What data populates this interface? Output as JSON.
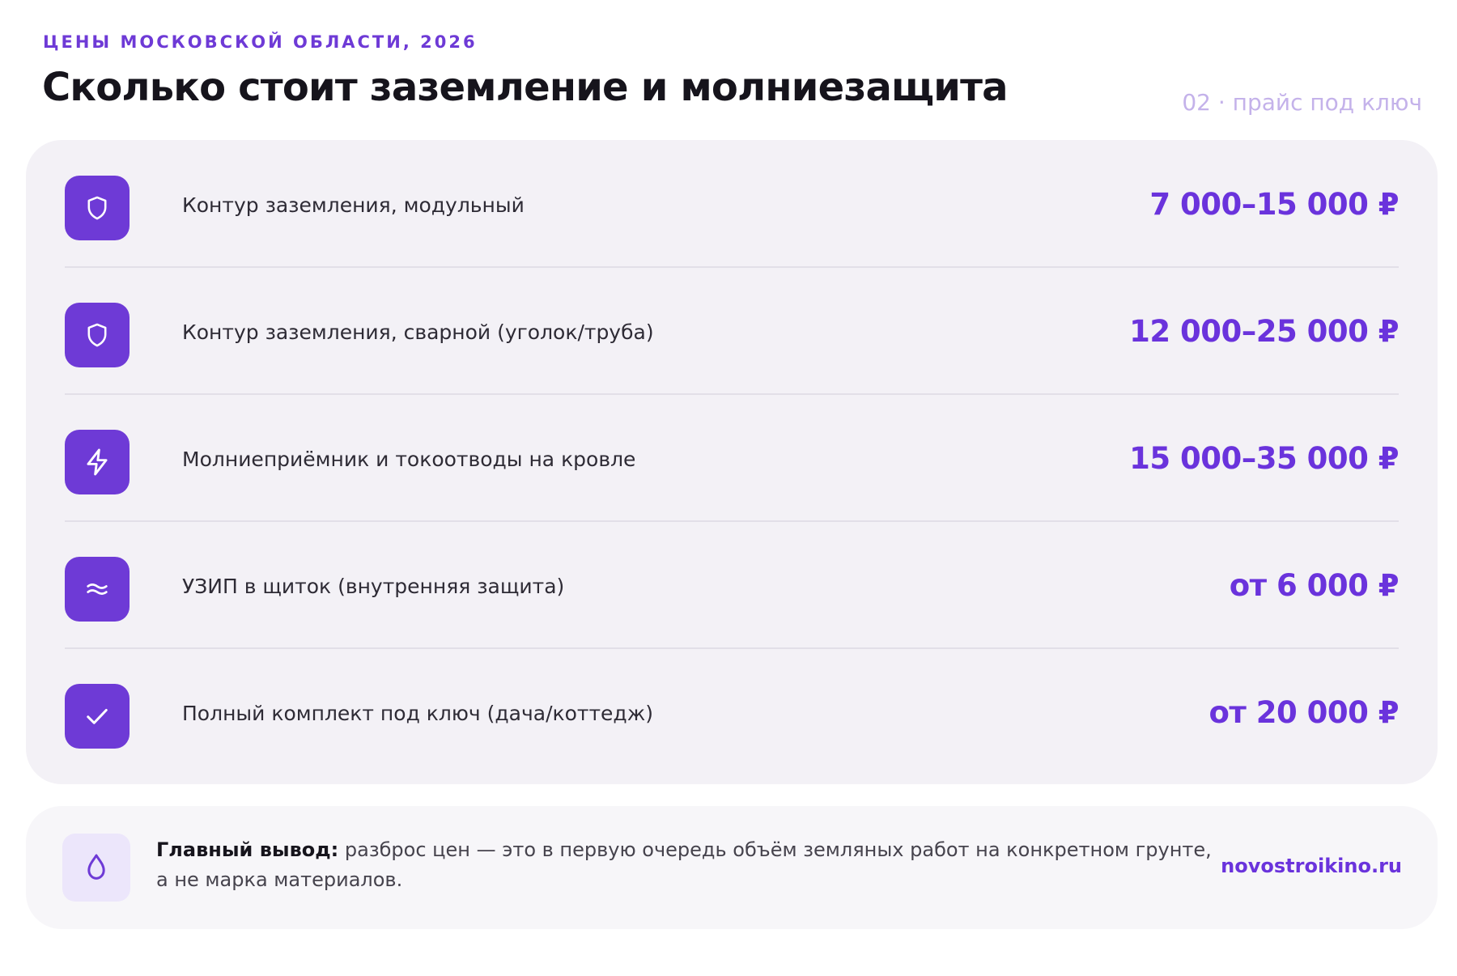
{
  "header": {
    "eyebrow": "ЦЕНЫ МОСКОВСКОЙ ОБЛАСТИ, 2026",
    "title": "Сколько стоит заземление и молниезащита",
    "kicker": "02 · прайс под ключ"
  },
  "price_list": {
    "rows": [
      {
        "icon": "shield-icon",
        "label": "Контур заземления, модульный",
        "price": "7 000–15 000 ₽"
      },
      {
        "icon": "shield-icon",
        "label": "Контур заземления, сварной (уголок/труба)",
        "price": "12 000–25 000 ₽"
      },
      {
        "icon": "lightning-icon",
        "label": "Молниеприёмник и токоотводы на кровле",
        "price": "15 000–35 000 ₽"
      },
      {
        "icon": "waves-icon",
        "label": "УЗИП в щиток (внутренняя защита)",
        "price": "от 6 000 ₽"
      },
      {
        "icon": "checkmark-icon",
        "label": "Полный комплект под ключ (дача/коттедж)",
        "price": "от 20 000 ₽"
      }
    ]
  },
  "note": {
    "icon": "droplet-icon",
    "lead": "Главный вывод:",
    "text": " разброс цен — это в первую очередь объём земляных работ на конкретном грунте, а не марка материалов.",
    "brand": "novostroikino.ru"
  },
  "colors": {
    "accent": "#6e3ad6",
    "price": "#6a33dc",
    "card_bg": "#f3f1f6",
    "kicker": "#c4b2ea"
  }
}
